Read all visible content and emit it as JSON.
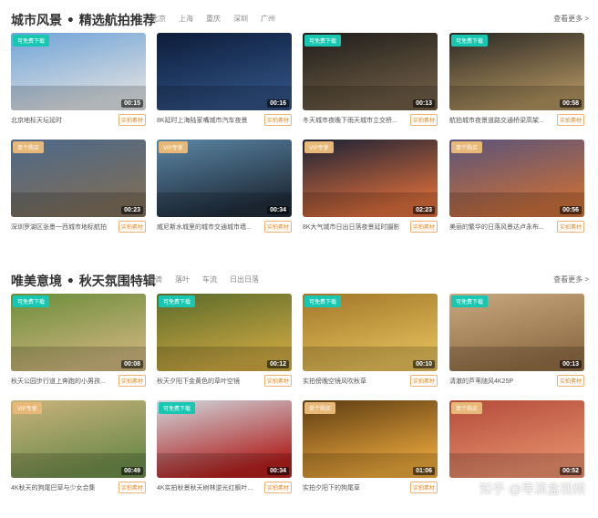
{
  "section1": {
    "title": "城市风景 • 精选航拍推荐",
    "tags": [
      "北京",
      "上海",
      "重庆",
      "深圳",
      "广州"
    ],
    "more": "查看更多 >",
    "cards": [
      {
        "badge": "可免费下载",
        "badge_type": "free",
        "duration": "00:15",
        "caption": "北京地标天坛延时",
        "tag": "实拍素材"
      },
      {
        "badge": "",
        "badge_type": "",
        "duration": "00:16",
        "caption": "8K延时上海陆家嘴城市汽车夜景",
        "tag": "实拍素材"
      },
      {
        "badge": "可免费下载",
        "badge_type": "free",
        "duration": "00:13",
        "caption": "冬天城市夜晚下雨天城市立交桥...",
        "tag": "实拍素材"
      },
      {
        "badge": "可免费下载",
        "badge_type": "free",
        "duration": "00:58",
        "caption": "航拍城市夜景道路交通桥梁高架...",
        "tag": "实拍素材"
      },
      {
        "badge": "单个购买",
        "badge_type": "single",
        "duration": "00:23",
        "caption": "深圳罗湖区张墨一西城市地标航拍",
        "tag": "实拍素材"
      },
      {
        "badge": "VIP专享",
        "badge_type": "vip",
        "duration": "00:34",
        "caption": "威尼斯水城里的城市交通城市墙...",
        "tag": "实拍素材"
      },
      {
        "badge": "VIP专享",
        "badge_type": "vip",
        "duration": "02:23",
        "caption": "8K大气城市日出日落夜景延时摄影",
        "tag": "实拍素材"
      },
      {
        "badge": "单个购买",
        "badge_type": "single",
        "duration": "00:56",
        "caption": "美丽的繁华的日落风景达卢永布...",
        "tag": "实拍素材"
      }
    ]
  },
  "section2": {
    "title": "唯美意境 • 秋天氛围特辑",
    "tags": [
      "雨滴",
      "落叶",
      "车流",
      "日出日落"
    ],
    "more": "查看更多 >",
    "cards": [
      {
        "badge": "可免费下载",
        "badge_type": "free",
        "duration": "00:08",
        "caption": "秋天公园步行道上奔跑的小男孩...",
        "tag": "实拍素材"
      },
      {
        "badge": "可免费下载",
        "badge_type": "free",
        "duration": "00:12",
        "caption": "秋天夕阳下金黄色的草叶空镜",
        "tag": "实拍素材"
      },
      {
        "badge": "可免费下载",
        "badge_type": "free",
        "duration": "00:10",
        "caption": "实拍傍晚空镜风吹秋草",
        "tag": "实拍素材"
      },
      {
        "badge": "可免费下载",
        "badge_type": "free",
        "duration": "00:13",
        "caption": "清澈的芦苇随风4K25P",
        "tag": "实拍素材"
      },
      {
        "badge": "VIP专享",
        "badge_type": "vip",
        "duration": "00:49",
        "caption": "4K秋天的狗尾巴草与少女合集",
        "tag": "实拍素材"
      },
      {
        "badge": "可免费下载",
        "badge_type": "free",
        "duration": "00:34",
        "caption": "4K实拍秋景秋天树林逆光红枫叶...",
        "tag": "实拍素材"
      },
      {
        "badge": "单个购买",
        "badge_type": "single",
        "duration": "01:06",
        "caption": "实拍夕阳下的狗尾草",
        "tag": "实拍素材"
      },
      {
        "badge": "单个购买",
        "badge_type": "single",
        "duration": "00:52",
        "caption": "",
        "tag": ""
      }
    ]
  },
  "watermark": "知乎 @导演盒视频",
  "thumb_colors": {
    "s1": [
      [
        "#6fa3d8",
        "#d9dde0"
      ],
      [
        "#0c1c3a",
        "#2f4f7f"
      ],
      [
        "#1f1c1a",
        "#6b5a43"
      ],
      [
        "#2a2824",
        "#a98c5c"
      ],
      [
        "#4d6a8a",
        "#7b6c5a"
      ],
      [
        "#5b86a5",
        "#1f2c3a"
      ],
      [
        "#1b2236",
        "#d46a3a"
      ],
      [
        "#59547b",
        "#c46d3a"
      ]
    ],
    "s2": [
      [
        "#6b8d3a",
        "#c9b27a"
      ],
      [
        "#5a6a2a",
        "#c7a541"
      ],
      [
        "#a1762a",
        "#e0bb57"
      ],
      [
        "#c8a87e",
        "#8f6c45"
      ],
      [
        "#c9b27c",
        "#6d8a4a"
      ],
      [
        "#cfd7de",
        "#b0201e"
      ],
      [
        "#5c3b12",
        "#e4a23a"
      ],
      [
        "#b24b3a",
        "#e48c6a"
      ]
    ]
  }
}
